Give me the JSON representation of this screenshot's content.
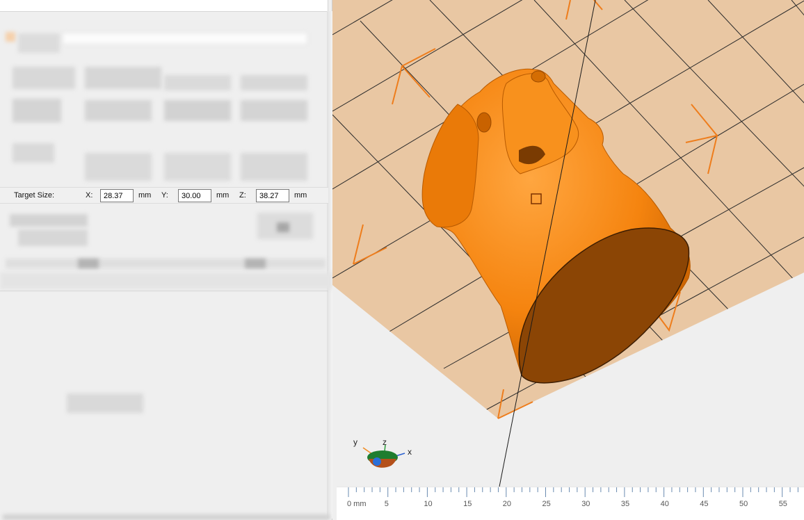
{
  "scale_panel": {
    "label": "Target Size:",
    "x_label": "X:",
    "x_value": "28.37",
    "y_label": "Y:",
    "y_value": "30.00",
    "z_label": "Z:",
    "z_value": "38.27",
    "unit": "mm"
  },
  "axis_gizmo": {
    "y_label": "y",
    "z_label": "z",
    "x_label": "x"
  },
  "ruler": {
    "labels": [
      "0 mm",
      "5",
      "10",
      "15",
      "20",
      "25",
      "30",
      "35",
      "40",
      "45",
      "50",
      "55"
    ]
  },
  "colors": {
    "model": "#f5840f",
    "model_cut_face": "#8b4505",
    "build_plate": "#e9c7a3",
    "grid_line": "#2a2a2a",
    "axis_marker": "#ee7d1c",
    "panel_bg": "#efefef"
  }
}
